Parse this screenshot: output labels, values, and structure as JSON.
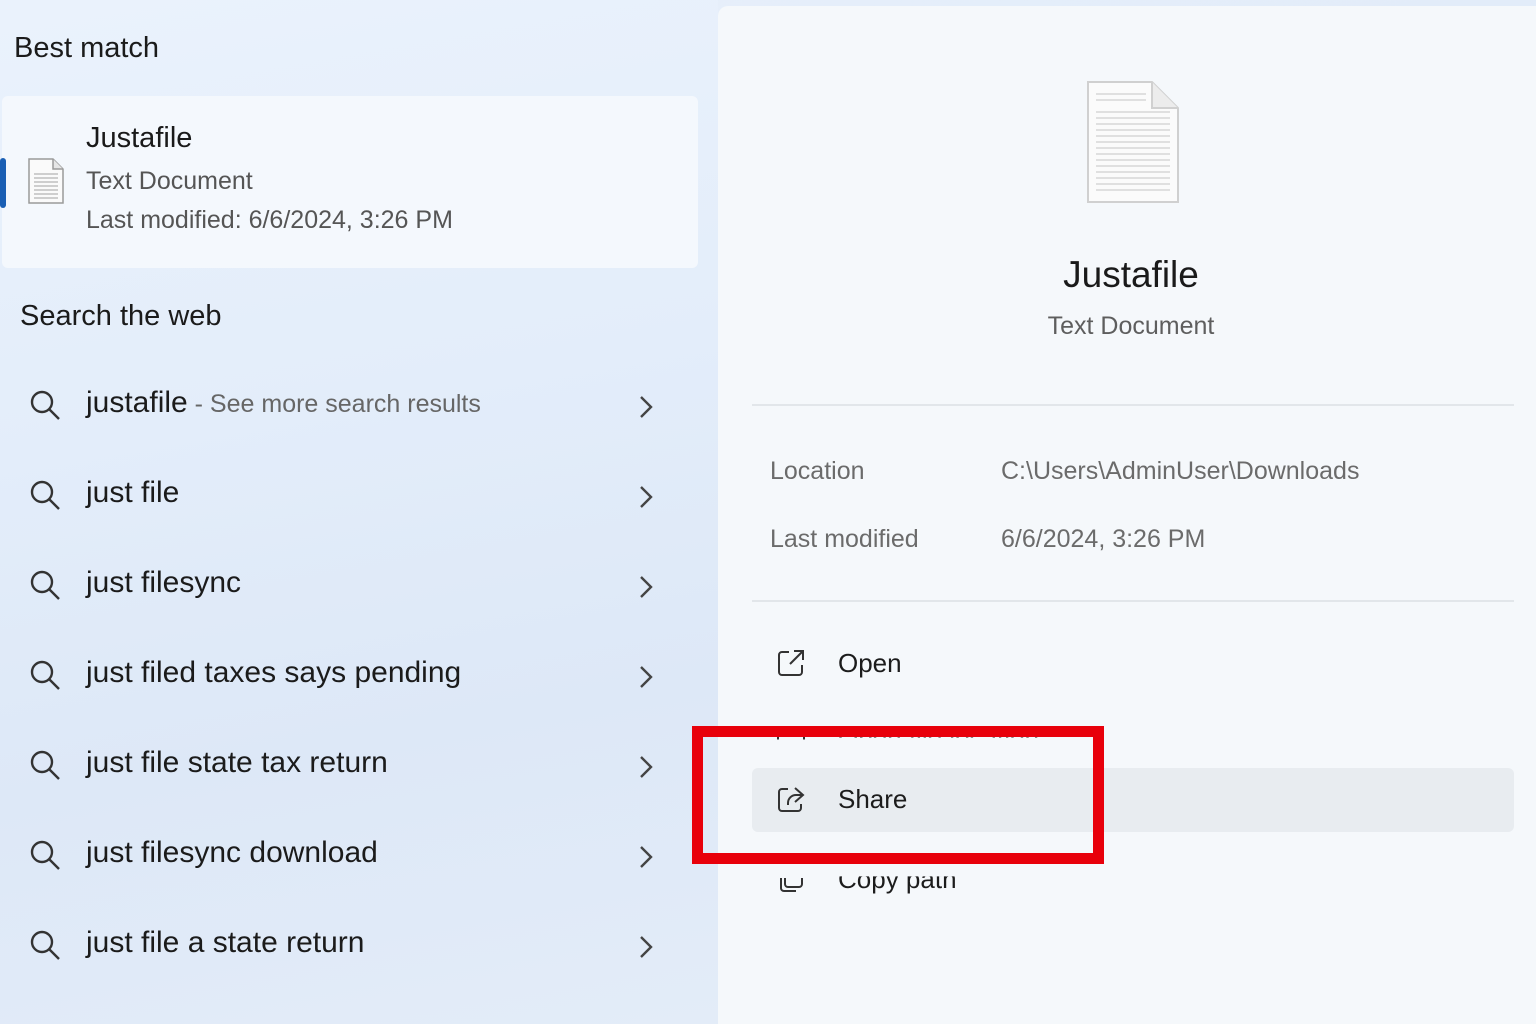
{
  "left_panel": {
    "best_match_heading": "Best match",
    "best_match": {
      "name": "Justafile",
      "type": "Text Document",
      "modified": "Last modified: 6/6/2024, 3:26 PM"
    },
    "web_heading": "Search the web",
    "web_results": [
      {
        "query": "justafile",
        "suffix": " - See more search results"
      },
      {
        "query": "just file",
        "suffix": ""
      },
      {
        "query": "just filesync",
        "suffix": ""
      },
      {
        "query": "just filed taxes says pending",
        "suffix": ""
      },
      {
        "query": "just file state tax return",
        "suffix": ""
      },
      {
        "query": "just filesync download",
        "suffix": ""
      },
      {
        "query": "just file a state return",
        "suffix": ""
      }
    ]
  },
  "right_panel": {
    "title": "Justafile",
    "subtitle": "Text Document",
    "info": {
      "location_label": "Location",
      "location_value": "C:\\Users\\AdminUser\\Downloads",
      "modified_label": "Last modified",
      "modified_value": "6/6/2024, 3:26 PM"
    },
    "actions": {
      "open": "Open",
      "open_location": "Open file location",
      "share": "Share",
      "copy_path": "Copy path"
    }
  },
  "colors": {
    "accent": "#1a5fb4",
    "highlight_box": "#e8000b"
  },
  "icons": [
    "text-file-icon",
    "search-icon",
    "chevron-right-icon",
    "open-external-icon",
    "folder-icon",
    "share-icon",
    "copy-icon"
  ]
}
